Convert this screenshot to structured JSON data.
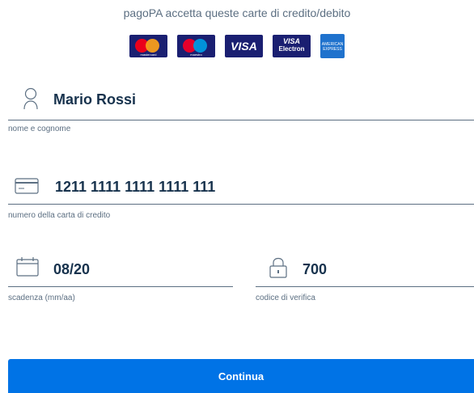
{
  "header": {
    "intro_text": "pagoPA accetta queste carte di credito/debito",
    "accepted_cards": [
      {
        "name": "mastercard",
        "label": "mastercard"
      },
      {
        "name": "maestro",
        "label": "maestro"
      },
      {
        "name": "visa",
        "label": "VISA"
      },
      {
        "name": "visa-electron",
        "label": "VISA",
        "sub_label": "Electron"
      },
      {
        "name": "american-express",
        "label": "AMERICAN EXPRESS"
      }
    ]
  },
  "form": {
    "name": {
      "value": "Mario Rossi",
      "label": "nome e cognome",
      "icon": "user-icon"
    },
    "card_number": {
      "value": "1211 1111 1111 1111 111",
      "label": "numero della carta di credito",
      "icon": "credit-card-icon"
    },
    "expiry": {
      "value": "08/20",
      "label": "scadenza (mm/aa)",
      "icon": "calendar-icon"
    },
    "cvv": {
      "value": "700",
      "label": "codice di verifica",
      "icon": "lock-icon"
    }
  },
  "actions": {
    "continue_label": "Continua"
  },
  "colors": {
    "accent": "#0073e6",
    "text": "#17324d",
    "muted": "#5c6f82"
  }
}
